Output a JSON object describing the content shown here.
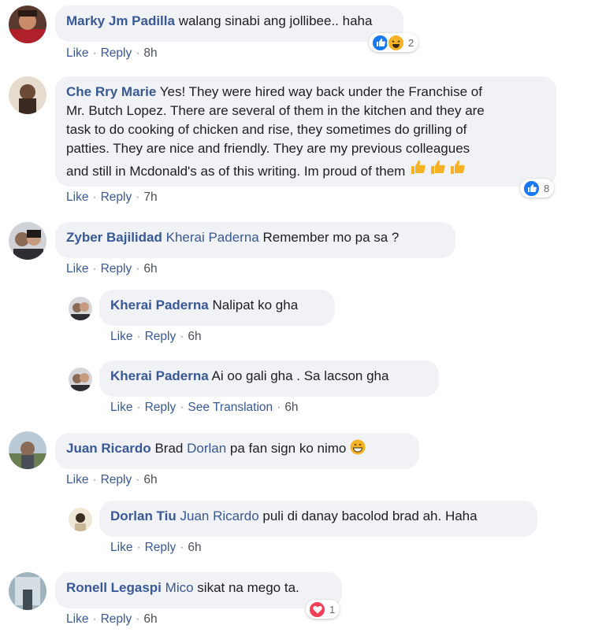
{
  "colors": {
    "author": "#385898",
    "bubble": "#f0f2f5",
    "like_blue": "#1877f2",
    "love_red": "#f33e58",
    "haha_yellow": "#f7b125"
  },
  "actions": {
    "like": "Like",
    "reply": "Reply",
    "see_translation": "See Translation",
    "sep": "·"
  },
  "comments": [
    {
      "author": "Marky Jm Padilla",
      "text": "walang sinabi ang jollibee.. haha",
      "time": "8h",
      "reactions": [
        "like-icon",
        "haha-icon"
      ],
      "reaction_count": "2"
    },
    {
      "author": "Che Rry Marie",
      "text_lines": [
        "Yes! They were hired way back under the Franchise of",
        "Mr. Butch Lopez. There are several of them in the kitchen and they are",
        "task to do cooking of chicken and rise, they sometimes do grilling of",
        "patties. They are nice and friendly. They are my previous colleagues",
        "and still in Mcdonald's as of this writing. Im proud of them"
      ],
      "emoji": "thumbs-up-icon x3",
      "time": "7h",
      "reaction_count": "8"
    },
    {
      "author": "Zyber Bajilidad",
      "mention": "Kherai Paderna",
      "text": "Remember mo pa sa ?",
      "time": "6h"
    },
    {
      "author": "Kherai Paderna",
      "text": "Nalipat ko gha",
      "time": "6h"
    },
    {
      "author": "Kherai Paderna",
      "text": "Ai oo gali gha . Sa lacson gha",
      "time": "6h"
    },
    {
      "author": "Juan Ricardo",
      "pre": "Brad",
      "mention": "Dorlan",
      "text": "pa fan sign ko nimo",
      "emoji": "grin-icon",
      "time": "6h"
    },
    {
      "author": "Dorlan Tiu",
      "mention": "Juan Ricardo",
      "text": "puli di danay bacolod brad ah. Haha",
      "time": "6h"
    },
    {
      "author": "Ronell Legaspi",
      "mention": "Mico",
      "text": "sikat na mego ta.",
      "time": "6h",
      "reaction_count": "1"
    }
  ]
}
